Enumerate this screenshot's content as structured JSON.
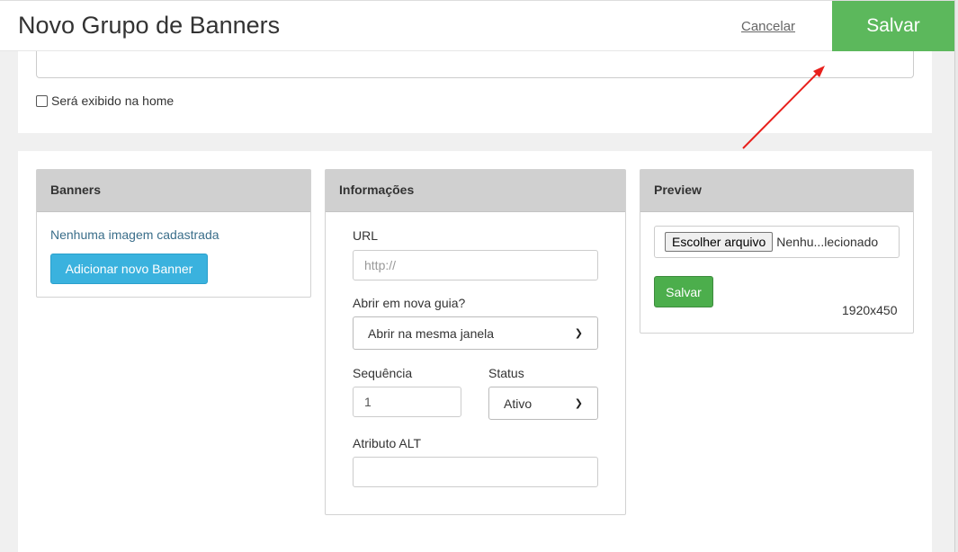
{
  "header": {
    "title": "Novo Grupo de Banners",
    "cancel_label": "Cancelar",
    "save_label": "Salvar"
  },
  "top_section": {
    "name_value": "",
    "home_checkbox_label": "Será exibido na home",
    "home_checked": false
  },
  "banners_panel": {
    "title": "Banners",
    "empty_text": "Nenhuma imagem cadastrada",
    "add_button_label": "Adicionar novo Banner"
  },
  "info_panel": {
    "title": "Informações",
    "url_label": "URL",
    "url_placeholder": "http://",
    "new_tab_label": "Abrir em nova guia?",
    "new_tab_selected": "Abrir na mesma janela",
    "sequence_label": "Sequência",
    "sequence_value": "1",
    "status_label": "Status",
    "status_selected": "Ativo",
    "alt_label": "Atributo ALT",
    "alt_value": ""
  },
  "preview_panel": {
    "title": "Preview",
    "file_button_label": "Escolher arquivo",
    "file_status": "Nenhu...lecionado",
    "save_button_label": "Salvar",
    "dimensions": "1920x450"
  },
  "colors": {
    "save_green": "#5cb85c",
    "add_blue": "#3ab2de",
    "annotation_arrow": "#e8201c"
  }
}
